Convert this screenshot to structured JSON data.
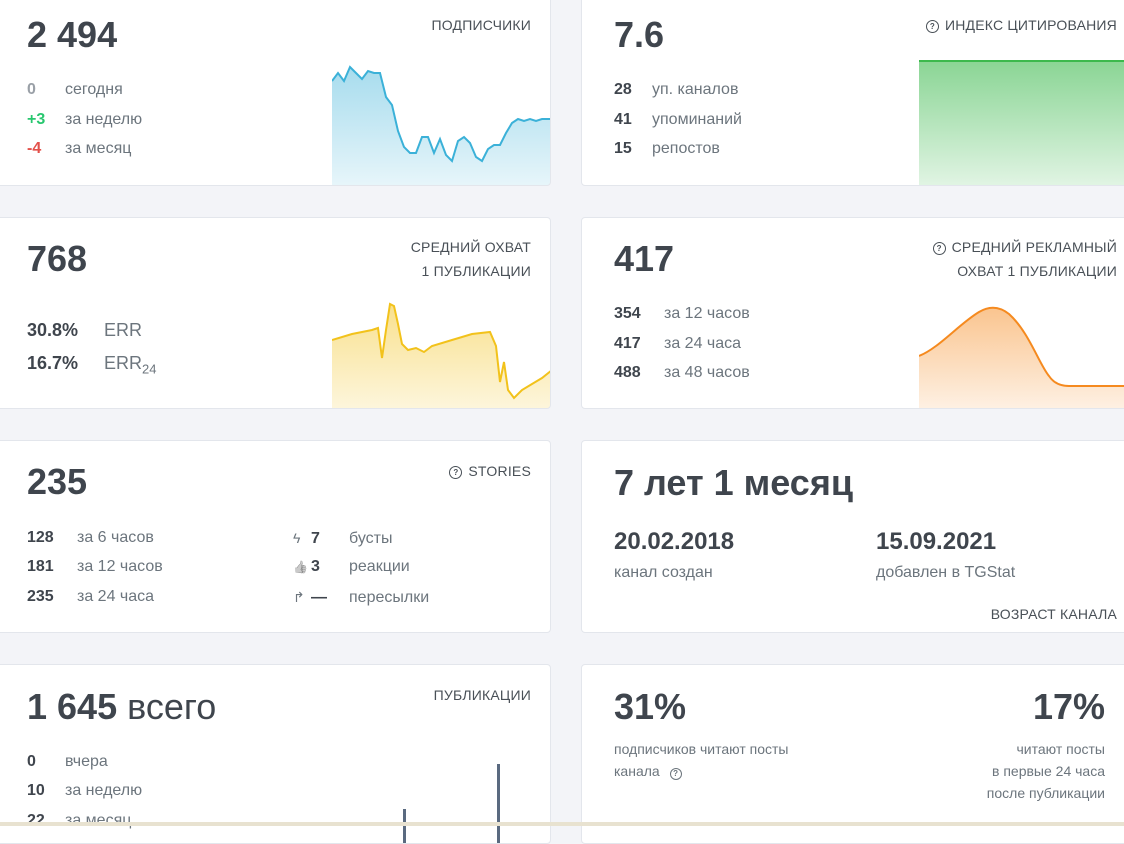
{
  "subscribers": {
    "title": "ПОДПИСЧИКИ",
    "value": "2 494",
    "rows": [
      {
        "num": "0",
        "label": "сегодня"
      },
      {
        "num": "+3",
        "label": "за неделю"
      },
      {
        "num": "-4",
        "label": "за месяц"
      }
    ],
    "chart_color": "#3bb1d8"
  },
  "citation": {
    "title": "ИНДЕКС ЦИТИРОВАНИЯ",
    "help_icon": "question-circle-icon",
    "value": "7.6",
    "rows": [
      {
        "num": "28",
        "label": "уп. каналов"
      },
      {
        "num": "41",
        "label": "упоминаний"
      },
      {
        "num": "15",
        "label": "репостов"
      }
    ],
    "chart_color": "#3cb94d"
  },
  "reach": {
    "title_line1": "СРЕДНИЙ ОХВАТ",
    "title_line2": "1 ПУБЛИКАЦИИ",
    "value": "768",
    "err": {
      "num": "30.8%",
      "label": "ERR"
    },
    "err24": {
      "num": "16.7%",
      "label": "ERR",
      "sub": "24"
    },
    "chart_color": "#f2c21b"
  },
  "ad_reach": {
    "title_line1": "СРЕДНИЙ РЕКЛАМНЫЙ",
    "title_line2": "ОХВАТ 1 ПУБЛИКАЦИИ",
    "help_icon": "question-circle-icon",
    "value": "417",
    "rows": [
      {
        "num": "354",
        "label": "за 12 часов"
      },
      {
        "num": "417",
        "label": "за 24 часа"
      },
      {
        "num": "488",
        "label": "за 48 часов"
      }
    ],
    "chart_color": "#f58a1f"
  },
  "stories": {
    "title": "STORIES",
    "help_icon": "question-circle-icon",
    "value": "235",
    "rows": [
      {
        "num": "128",
        "label": "за 6 часов"
      },
      {
        "num": "181",
        "label": "за 12 часов"
      },
      {
        "num": "235",
        "label": "за 24 часа"
      }
    ],
    "extra": [
      {
        "icon": "lightning-icon",
        "glyph": "ϟ",
        "num": "7",
        "label": "бусты"
      },
      {
        "icon": "thumbs-up-icon",
        "glyph": "👍",
        "num": "3",
        "label": "реакции"
      },
      {
        "icon": "share-arrow-icon",
        "glyph": "↱",
        "num": "—",
        "label": "пересылки"
      }
    ]
  },
  "age": {
    "title": "ВОЗРАСТ КАНАЛА",
    "value": "7 лет 1 месяц",
    "created_date": "20.02.2018",
    "created_label": "канал создан",
    "added_date": "15.09.2021",
    "added_label": "добавлен в TGStat"
  },
  "publications": {
    "title": "ПУБЛИКАЦИИ",
    "value": "1 645",
    "value_suffix": "всего",
    "rows": [
      {
        "num": "0",
        "label": "вчера"
      },
      {
        "num": "10",
        "label": "за неделю"
      },
      {
        "num": "22",
        "label": "за месяц"
      }
    ],
    "chart_color": "#5a6a80"
  },
  "readers": {
    "left_value": "31%",
    "left_label_line1": "подписчиков читают посты",
    "left_label_line2": "канала",
    "help_icon": "question-circle-icon",
    "right_value": "17%",
    "right_label_line1": "читают посты",
    "right_label_line2": "в первые 24 часа",
    "right_label_line3": "после публикации"
  }
}
